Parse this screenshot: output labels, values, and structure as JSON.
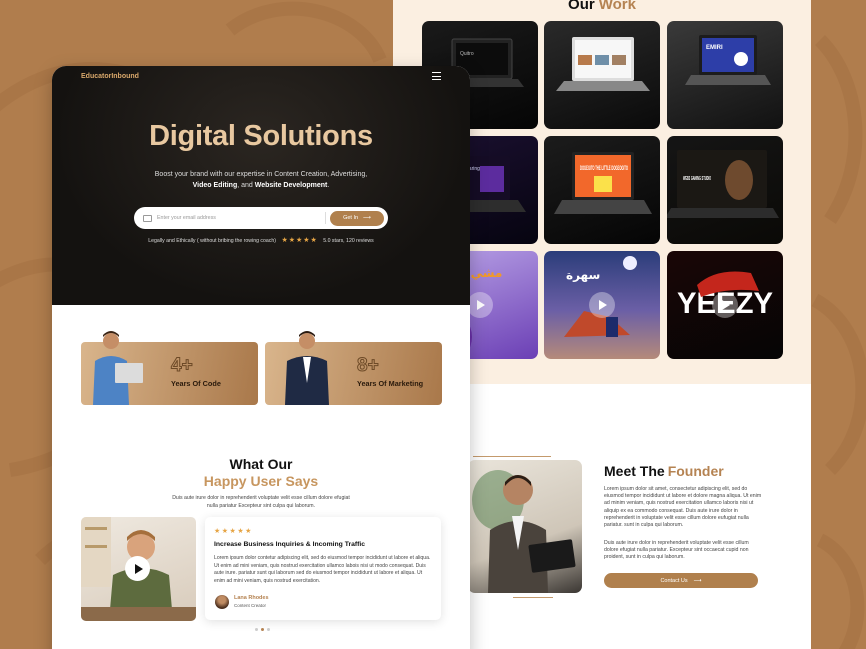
{
  "colors": {
    "accent": "#b0804d",
    "background": "#b07d4d",
    "hero": "#141210"
  },
  "work": {
    "title_a": "Our",
    "title_b": "Work"
  },
  "tiles": [
    {
      "caption": "Quitro",
      "play": false
    },
    {
      "caption": "",
      "play": false
    },
    {
      "caption": "EMIRI",
      "play": false
    },
    {
      "caption": "Gamer Sharing",
      "play": false
    },
    {
      "caption": "DOGEGITO THE LITTLE DOGEOGITO",
      "play": false
    },
    {
      "caption": "WEB3 GAMING STUDIO",
      "play": false
    },
    {
      "caption": "مشي صحي",
      "play": true
    },
    {
      "caption": "سهرة",
      "play": true
    },
    {
      "caption": "YEEZY",
      "play": true
    }
  ],
  "founder": {
    "title_a": "Meet The",
    "title_b": "Founder",
    "p1": "Lorem ipsum dolor sit amet, consectetur adipiscing elit, sed do eiusmod tempor incididunt ut labore et dolore magna aliqua. Ut enim ad minim veniam, quis nostrud exercitation ullamco laboris nisi ut aliquip ex ea commodo consequat. Duis aute irure dolor in reprehenderit in voluptate velit esse cillum dolore eufugiat nulla pariatur. sunt in culpa qui laborum.",
    "p2": "Duis aute irure dolor in reprehenderit voluptate velit esse cillum dolore efugiat nulla pariatur. Excepteur sint occaecat cupid non proident, sunt in culpa qui laborum.",
    "button": "Contact Us",
    "arrow": "⟶"
  },
  "header": {
    "logo": "EducatorInbound"
  },
  "hero": {
    "title": "Digital Solutions",
    "sub_a": "Boost your brand with our expertise in Content Creation, Advertising,",
    "sub_b1": "Video Editing",
    "sub_b2": ", and ",
    "sub_b3": "Website Development",
    "sub_b4": ".",
    "placeholder": "Enter your email address",
    "button": "Get In",
    "arrow": "⟶",
    "rating_text": "Legally and Ethically ( without bribing the rowing coach)",
    "stars": "★★★★★",
    "rating_meta": "5.0 stars, 120 reviews"
  },
  "stats": [
    {
      "number": "4+",
      "label": "Years Of Code"
    },
    {
      "number": "8+",
      "label": "Years Of Marketing"
    }
  ],
  "testimonials": {
    "title_a": "What Our",
    "title_b": "Happy User Says",
    "sub": "Duis aute irure dolor in reprehenderit voluptate velit esse cillum dolore efugiat nulla pariatur Excepteur sint culpa qui laborum.",
    "stars": "★★★★★",
    "review_title": "Increase Business Inquiries & Incoming Traffic",
    "review_body": "Lorem ipsum dolor contetur adipiscing elit, sed do eiusmod tempor incididunt ut labore et aliqua. Ut enim ad mini veniam, quis nostrud exercitation ullamco labois nisi ut modo consequat. Duis aute irure. pariatur sunt qui laborum sed do eiusmod tempor incididunt ut labore et aliqua. Ut enim ad mini veniam, quis nostrud exercitation.",
    "name": "Lana Rhodes",
    "role": "Content Creator"
  }
}
